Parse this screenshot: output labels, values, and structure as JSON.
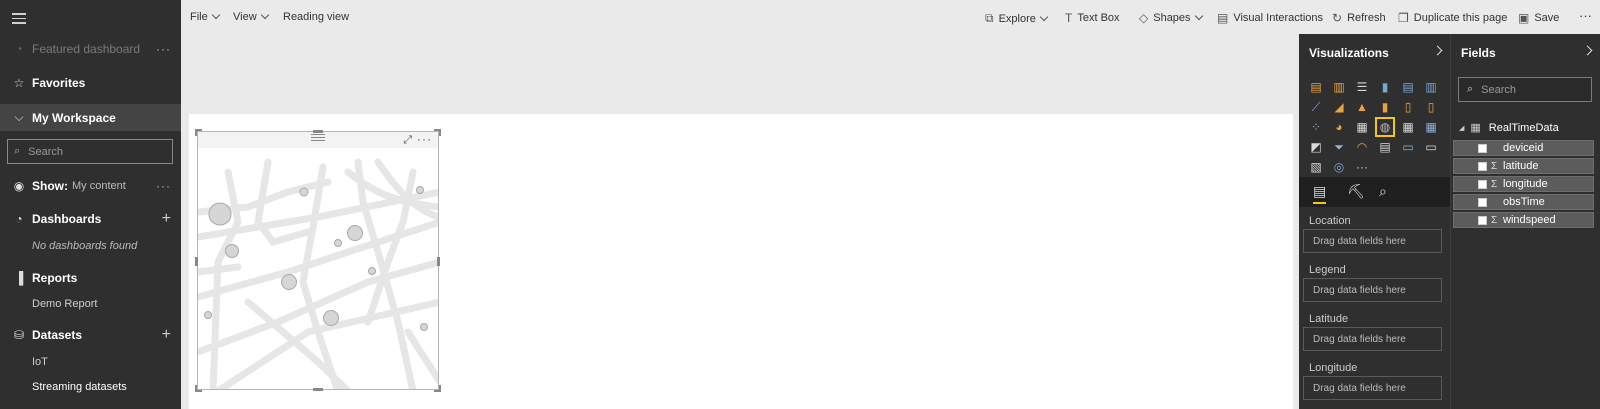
{
  "nav": {
    "featured": "Featured dashboard",
    "favorites": "Favorites",
    "workspace": "My Workspace",
    "search_placeholder": "Search",
    "show_label": "Show:",
    "show_value": "My content",
    "dashboards": "Dashboards",
    "no_dashboards": "No dashboards found",
    "reports": "Reports",
    "demo_report": "Demo Report",
    "datasets": "Datasets",
    "iot": "IoT",
    "streaming": "Streaming datasets",
    "more": "···"
  },
  "toolbar": {
    "file": "File",
    "view": "View",
    "reading_view": "Reading view",
    "explore": "Explore",
    "text_box": "Text Box",
    "shapes": "Shapes",
    "visual_interactions": "Visual Interactions",
    "refresh": "Refresh",
    "duplicate": "Duplicate this page",
    "save": "Save",
    "more": "···"
  },
  "visual": {
    "more": "···"
  },
  "viz_pane": {
    "title": "Visualizations",
    "more": "···",
    "wells": [
      {
        "label": "Location",
        "placeholder": "Drag data fields here"
      },
      {
        "label": "Legend",
        "placeholder": "Drag data fields here"
      },
      {
        "label": "Latitude",
        "placeholder": "Drag data fields here"
      },
      {
        "label": "Longitude",
        "placeholder": "Drag data fields here"
      }
    ]
  },
  "fields_pane": {
    "title": "Fields",
    "search_placeholder": "Search",
    "table": "RealTimeData",
    "fields": [
      {
        "name": "deviceid",
        "sigma": ""
      },
      {
        "name": "latitude",
        "sigma": "Σ"
      },
      {
        "name": "longitude",
        "sigma": "Σ"
      },
      {
        "name": "obsTime",
        "sigma": ""
      },
      {
        "name": "windspeed",
        "sigma": "Σ"
      }
    ]
  }
}
